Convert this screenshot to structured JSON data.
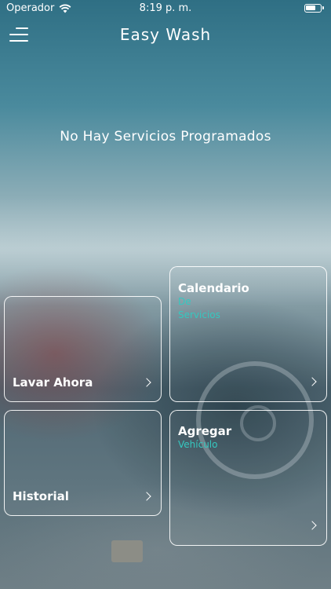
{
  "status_bar": {
    "carrier": "Operador",
    "time": "8:19 p. m."
  },
  "nav": {
    "title": "Easy Wash",
    "menu_icon": "hamburger-menu-icon"
  },
  "empty_message": "No Hay Servicios Programados",
  "cards": {
    "calendario": {
      "title": "Calendario",
      "sub1": "De",
      "sub2": "Servicios"
    },
    "lavar": {
      "title": "Lavar Ahora"
    },
    "agregar": {
      "title": "Agregar",
      "sub1": "Vehículo"
    },
    "historial": {
      "title": "Historial"
    }
  },
  "colors": {
    "accent": "#35c8c0",
    "card_border": "#ffffff"
  }
}
